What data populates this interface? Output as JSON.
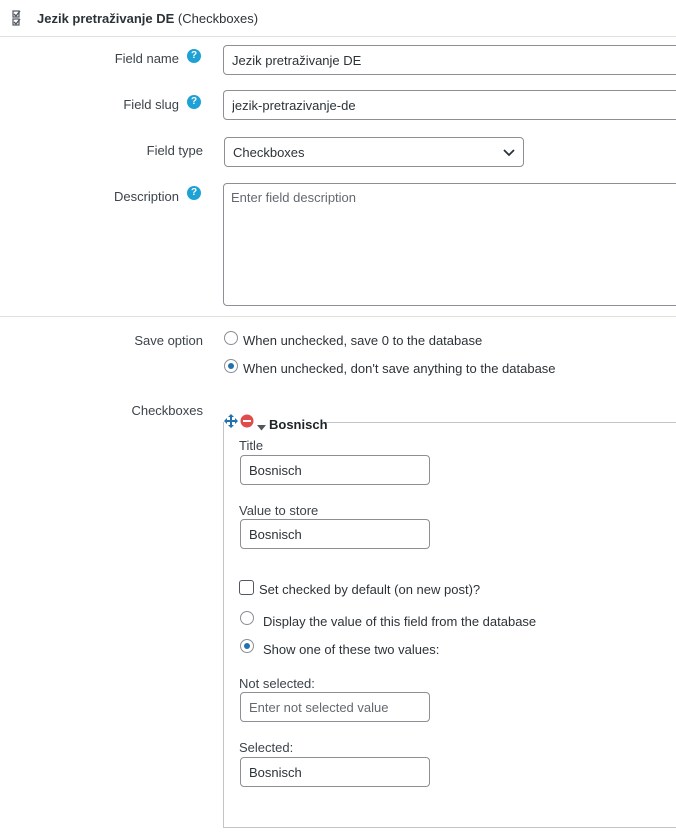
{
  "header": {
    "title": "Jezik pretraživanje DE",
    "type_suffix": "(Checkboxes)"
  },
  "fields": {
    "name": {
      "label": "Field name",
      "value": "Jezik pretraživanje DE"
    },
    "slug": {
      "label": "Field slug",
      "value": "jezik-pretrazivanje-de"
    },
    "type": {
      "label": "Field type",
      "value": "Checkboxes"
    },
    "description": {
      "label": "Description",
      "placeholder": "Enter field description"
    }
  },
  "help_glyph": "?",
  "save_option": {
    "label": "Save option",
    "options": [
      {
        "label": "When unchecked, save 0 to the database",
        "checked": false
      },
      {
        "label": "When unchecked, don't save anything to the database",
        "checked": true
      }
    ]
  },
  "checkboxes": {
    "label": "Checkboxes",
    "item": {
      "name": "Bosnisch",
      "title_label": "Title",
      "title_value": "Bosnisch",
      "value_label": "Value to store",
      "value_value": "Bosnisch",
      "default_checked_label": "Set checked by default (on new post)?",
      "display_options": [
        {
          "label": "Display the value of this field from the database",
          "checked": false
        },
        {
          "label": "Show one of these two values:",
          "checked": true
        }
      ],
      "not_selected_label": "Not selected:",
      "not_selected_placeholder": "Enter not selected value",
      "selected_label": "Selected:",
      "selected_value": "Bosnisch"
    }
  },
  "colors": {
    "accent": "#2271b1",
    "help": "#1ea2d6",
    "delete": "#d63638",
    "move": "#2271b1"
  }
}
